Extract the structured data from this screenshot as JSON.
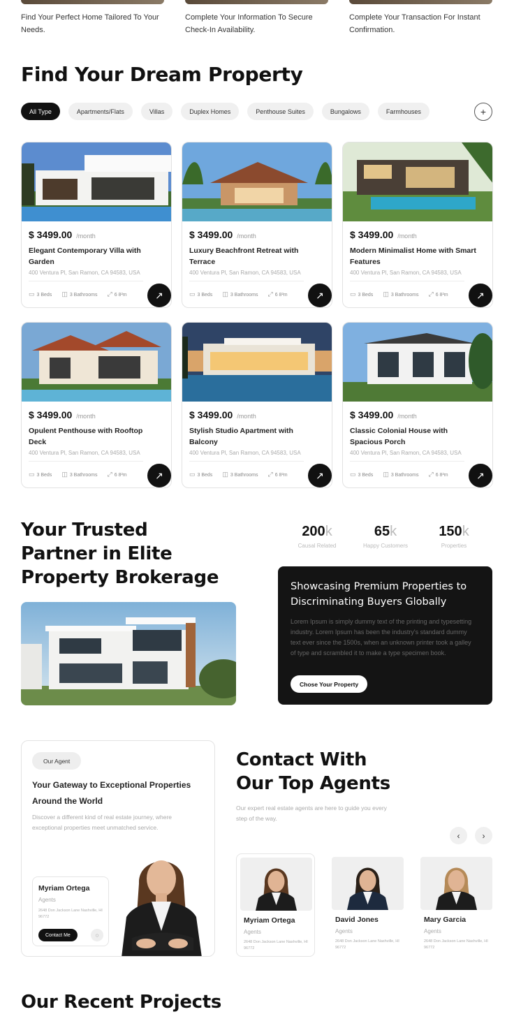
{
  "top_features": [
    {
      "text": "Find Your Perfect Home Tailored To Your Needs."
    },
    {
      "text": "Complete Your Information To Secure Check-In Availability."
    },
    {
      "text": "Complete Your Transaction For Instant Confirmation."
    }
  ],
  "properties_section": {
    "title": "Find Your Dream Property",
    "filters": [
      "All Type",
      "Apartments/Flats",
      "Villas",
      "Duplex Homes",
      "Penthouse Suites",
      "Bungalows",
      "Farmhouses"
    ],
    "active_filter": "All Type",
    "more_icon": "plus-icon"
  },
  "cards": [
    {
      "price": "$ 3499.00",
      "period": "/month",
      "title": "Elegant Contemporary Villa with Garden",
      "address": "400 Ventura Pl, San Ramon, CA 94583, USA",
      "beds": "3 Beds",
      "baths": "3 Bathrooms",
      "area": "6 8²m"
    },
    {
      "price": "$ 3499.00",
      "period": "/month",
      "title": "Luxury Beachfront Retreat with Terrace",
      "address": "400 Ventura Pl, San Ramon, CA 94583, USA",
      "beds": "3 Beds",
      "baths": "3 Bathrooms",
      "area": "6 8²m"
    },
    {
      "price": "$ 3499.00",
      "period": "/month",
      "title": "Modern Minimalist Home with Smart Features",
      "address": "400 Ventura Pl, San Ramon, CA 94583, USA",
      "beds": "3 Beds",
      "baths": "3 Bathrooms",
      "area": "6 8²m"
    },
    {
      "price": "$ 3499.00",
      "period": "/month",
      "title": "Opulent Penthouse with Rooftop Deck",
      "address": "400 Ventura Pl, San Ramon, CA 94583, USA",
      "beds": "3 Beds",
      "baths": "3 Bathrooms",
      "area": "6 8²m"
    },
    {
      "price": "$ 3499.00",
      "period": "/month",
      "title": "Stylish Studio Apartment with Balcony",
      "address": "400 Ventura Pl, San Ramon, CA 94583, USA",
      "beds": "3 Beds",
      "baths": "3 Bathrooms",
      "area": "6 8²m"
    },
    {
      "price": "$ 3499.00",
      "period": "/month",
      "title": "Classic Colonial House with Spacious Porch",
      "address": "400 Ventura Pl, San Ramon, CA 94583, USA",
      "beds": "3 Beds",
      "baths": "3 Bathrooms",
      "area": "6 8²m"
    }
  ],
  "trusted": {
    "title_lines": [
      "Your Trusted",
      "Partner in Elite",
      "Property Brokerage"
    ],
    "stats": [
      {
        "num": "200",
        "suffix": "k",
        "label": "Causal Related"
      },
      {
        "num": "65",
        "suffix": "k",
        "label": "Happy Customers"
      },
      {
        "num": "150",
        "suffix": "k",
        "label": "Properties"
      }
    ],
    "box_title": "Showcasing Premium Properties to Discriminating Buyers Globally",
    "box_text": "Lorem Ipsum is simply dummy text of the printing and typesetting industry. Lorem Ipsum has been the industry's standard dummy text ever since the 1500s, when an unknown printer took a galley of type and scrambled it to make a type specimen book.",
    "box_button": "Chose Your Property"
  },
  "agents": {
    "pill": "Our Agent",
    "gateway_title": "Your Gateway to Exceptional Properties Around the World",
    "gateway_text": "Discover a different kind of real estate journey, where exceptional properties meet unmatched service.",
    "featured": {
      "name": "Myriam Ortega",
      "role": "Agents",
      "address": "2648 Don Jackson Lane Nashville, HI 96772",
      "button": "Contact Me"
    },
    "section_title_lines": [
      "Contact With",
      "Our Top Agents"
    ],
    "section_text": "Our expert real estate agents are here to guide you every step of the way.",
    "prev_icon": "chevron-left-icon",
    "next_icon": "chevron-right-icon",
    "list": [
      {
        "name": "Myriam Ortega",
        "role": "Agents",
        "address": "2648 Don Jackson Lane Nashville, HI 96772"
      },
      {
        "name": "David Jones",
        "role": "Agents",
        "address": "2648 Don Jackson Lane Nashville, HI 96772"
      },
      {
        "name": "Mary Garcia",
        "role": "Agents",
        "address": "2648 Don Jackson Lane Nashville, HI 96772"
      }
    ]
  },
  "recent": {
    "title": "Our Recent Projects"
  }
}
